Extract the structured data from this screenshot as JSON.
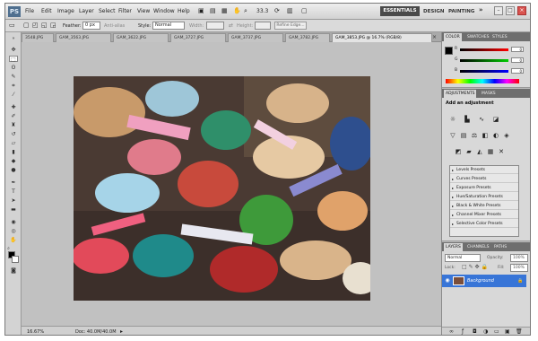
{
  "app": {
    "logo": "PS",
    "menu": [
      "File",
      "Edit",
      "Image",
      "Layer",
      "Select",
      "Filter",
      "View",
      "Window",
      "Help"
    ],
    "zoom_readout": "33.3",
    "workspace": {
      "essentials": "ESSENTIALS",
      "design": "DESIGN",
      "painting": "PAINTING",
      "more": "»"
    },
    "window_controls": {
      "minimize": "–",
      "restore": "□",
      "close": "×"
    }
  },
  "options_bar": {
    "feather_label": "Feather:",
    "feather_value": "0 px",
    "antialias_label": "Anti-alias",
    "style_label": "Style:",
    "style_value": "Normal",
    "width_label": "Width:",
    "height_label": "Height:",
    "refine_edge": "Refine Edge..."
  },
  "tabs": [
    {
      "label": "3548.JPG"
    },
    {
      "label": "GAM_3563.JPG"
    },
    {
      "label": "GAM_3622.JPG"
    },
    {
      "label": "GAM_3727.JPG"
    },
    {
      "label": "GAM_3737.JPG"
    },
    {
      "label": "GAM_3782.JPG"
    },
    {
      "label": "GAM_3853.JPG @ 16.7% (RGB/8)"
    }
  ],
  "status": {
    "zoom": "16.67%",
    "doc": "Doc: 40.0M/40.0M"
  },
  "color_panel": {
    "tabs": [
      "COLOR",
      "SWATCHES",
      "STYLES"
    ],
    "channels": [
      {
        "label": "R",
        "value": "0",
        "color": "#ff0000"
      },
      {
        "label": "G",
        "value": "0",
        "color": "#00aa00"
      },
      {
        "label": "B",
        "value": "0",
        "color": "#0000ff"
      }
    ]
  },
  "adjustments_panel": {
    "tabs": [
      "ADJUSTMENTS",
      "MASKS"
    ],
    "title": "Add an adjustment",
    "presets": [
      "Levels Presets",
      "Curves Presets",
      "Exposure Presets",
      "Hue/Saturation Presets",
      "Black & White Presets",
      "Channel Mixer Presets",
      "Selective Color Presets"
    ]
  },
  "layers_panel": {
    "tabs": [
      "LAYERS",
      "CHANNELS",
      "PATHS"
    ],
    "blend_mode": "Normal",
    "opacity_label": "Opacity:",
    "opacity_value": "100%",
    "lock_label": "Lock:",
    "fill_label": "Fill:",
    "fill_value": "100%",
    "layer_name": "Background"
  },
  "colors": {
    "selection": "#3875d7",
    "accent": "#4f6f8f"
  }
}
